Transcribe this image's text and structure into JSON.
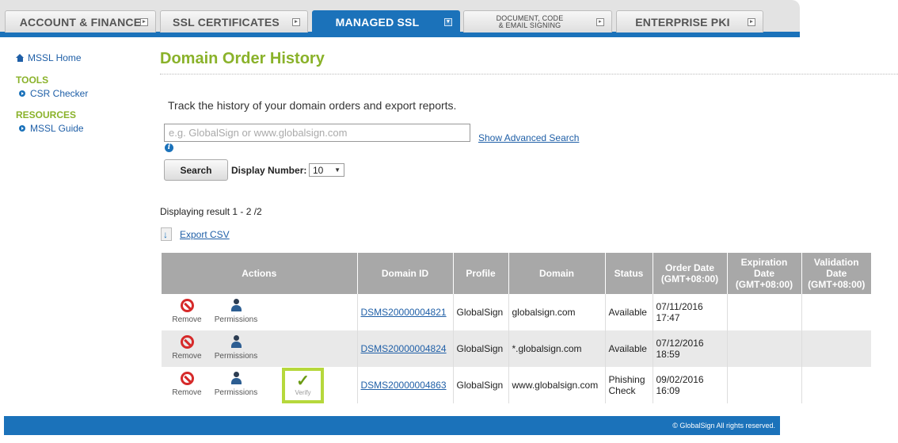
{
  "tabs": [
    {
      "label": "ACCOUNT & FINANCE",
      "active": false
    },
    {
      "label": "SSL CERTIFICATES",
      "active": false
    },
    {
      "label": "MANAGED SSL",
      "active": true
    },
    {
      "label_line1": "DOCUMENT, CODE",
      "label_line2": "& EMAIL SIGNING",
      "active": false
    },
    {
      "label": "ENTERPRISE PKI",
      "active": false
    }
  ],
  "sidebar": {
    "home": "MSSL Home",
    "tools_heading": "TOOLS",
    "csr_checker": "CSR Checker",
    "resources_heading": "RESOURCES",
    "mssl_guide": "MSSL Guide"
  },
  "page": {
    "title": "Domain Order History",
    "intro": "Track the history of your domain orders and export reports.",
    "search_placeholder": "e.g. GlobalSign or www.globalsign.com",
    "advanced_search": "Show Advanced Search",
    "search_button": "Search",
    "display_number_label": "Display Number:",
    "display_number_value": "10",
    "result_count": "Displaying result 1 - 2 /2",
    "export_csv": "Export CSV"
  },
  "table": {
    "headers": {
      "actions": "Actions",
      "domain_id": "Domain ID",
      "profile": "Profile",
      "domain": "Domain",
      "status": "Status",
      "order_date": "Order Date",
      "order_date_tz": "(GMT+08:00)",
      "expiration": "Expiration",
      "expiration_2": "Date",
      "expiration_tz": "(GMT+08:00)",
      "validation": "Validation",
      "validation_2": "Date",
      "validation_tz": "(GMT+08:00)"
    },
    "action_labels": {
      "remove": "Remove",
      "permissions": "Permissions",
      "verify": "Verify"
    },
    "rows": [
      {
        "domain_id": "DSMS20000004821",
        "profile": "GlobalSign",
        "domain": "globalsign.com",
        "status": "Available",
        "order_date": "07/11/2016",
        "order_time": "17:47"
      },
      {
        "domain_id": "DSMS20000004824",
        "profile": "GlobalSign",
        "domain": "*.globalsign.com",
        "status": "Available",
        "order_date": "07/12/2016",
        "order_time": "18:59"
      },
      {
        "domain_id": "DSMS20000004863",
        "profile": "GlobalSign",
        "domain": "www.globalsign.com",
        "status": "Phishing",
        "status_2": "Check",
        "order_date": "09/02/2016",
        "order_time": "16:09"
      }
    ]
  },
  "footer": "© GlobalSign All rights reserved."
}
